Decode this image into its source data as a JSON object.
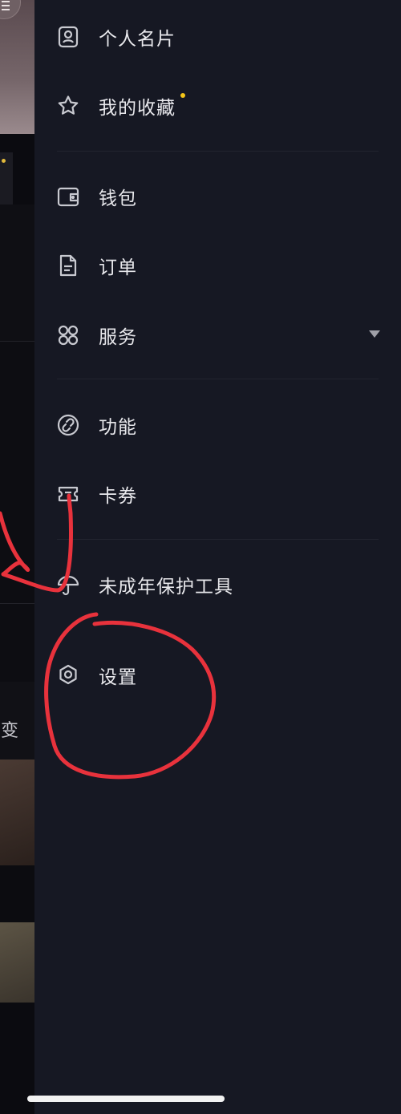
{
  "menu": {
    "items": [
      {
        "label": "个人名片",
        "icon": "contact-card-icon"
      },
      {
        "label": "我的收藏",
        "icon": "star-icon",
        "badge_dot": true
      },
      {
        "label": "钱包",
        "icon": "wallet-icon"
      },
      {
        "label": "订单",
        "icon": "document-icon"
      },
      {
        "label": "服务",
        "icon": "grid-icon",
        "expandable": true
      },
      {
        "label": "功能",
        "icon": "link-icon"
      },
      {
        "label": "卡券",
        "icon": "ticket-icon"
      },
      {
        "label": "未成年保护工具",
        "icon": "umbrella-icon"
      },
      {
        "label": "设置",
        "icon": "gear-icon"
      }
    ]
  },
  "background": {
    "partial_text": "变"
  },
  "colors": {
    "drawer_bg": "#161823",
    "text": "#e8e8ec",
    "icon": "#c8c9d0",
    "badge": "#f5c518",
    "annotation": "#e8323c"
  }
}
